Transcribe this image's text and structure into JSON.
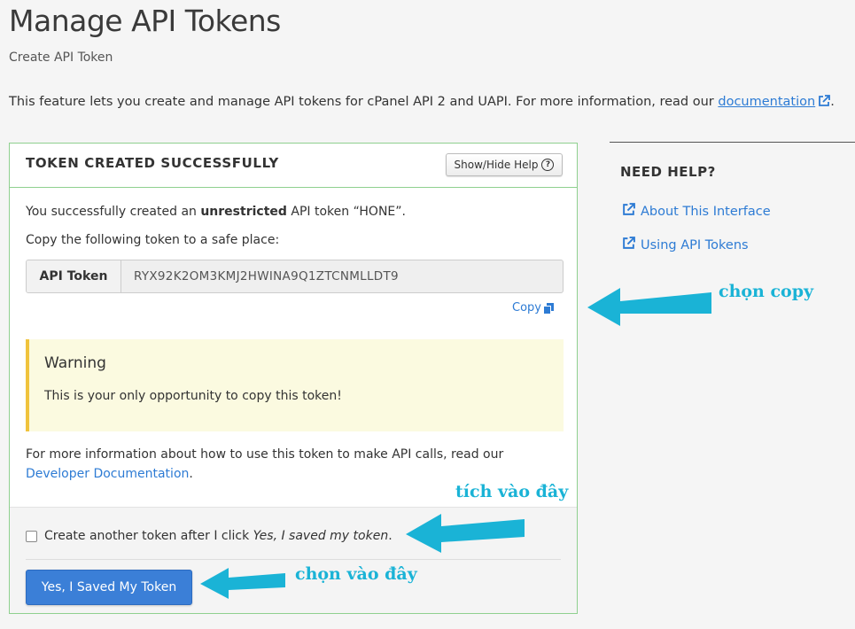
{
  "page": {
    "title": "Manage API Tokens",
    "subtitle": "Create API Token",
    "intro_text": "This feature lets you create and manage API tokens for cPanel API 2 and UAPI. For more information, read our ",
    "intro_link": "documentation",
    "intro_end": "."
  },
  "card": {
    "title": "TOKEN CREATED SUCCESSFULLY",
    "help_button": "Show/Hide Help",
    "help_button_icon": "?",
    "success_prefix": "You successfully created an ",
    "success_bold": "unrestricted",
    "success_suffix": " API token “HONE”.",
    "copy_instruction": "Copy the following token to a safe place:",
    "token_label": "API Token",
    "token_value": "RYX92K2OM3KMJ2HWINA9Q1ZTCNMLLDT9",
    "copy_label": "Copy",
    "warning_title": "Warning",
    "warning_text": "This is your only opportunity to copy this token!",
    "info_text": "For more information about how to use this token to make API calls, read our",
    "info_link": "Developer Documentation",
    "info_end": ".",
    "checkbox_prefix": "Create another token after I click ",
    "checkbox_italic": "Yes, I saved my token",
    "checkbox_suffix": ".",
    "checkbox_checked": false,
    "save_button": "Yes, I Saved My Token"
  },
  "help_panel": {
    "title": "NEED HELP?",
    "links": [
      "About This Interface",
      "Using API Tokens"
    ]
  },
  "annotations": {
    "copy_note": "chọn copy",
    "checkbox_note": "tích vào đây",
    "button_note": "chọn vào đây",
    "color": "#1ab3d6"
  },
  "colors": {
    "accent_blue": "#2d7bd4",
    "card_border": "#8fd08f",
    "warning_bg": "#fbfae0",
    "warning_border": "#f0c33c",
    "primary_button": "#3b7fd7"
  }
}
